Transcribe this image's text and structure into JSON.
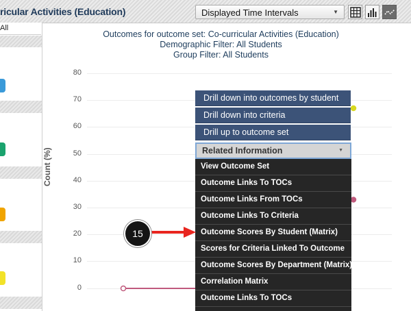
{
  "header": {
    "title": "ricular Activities (Education)",
    "interval_select": {
      "value": "Displayed Time Intervals"
    },
    "view_buttons": {
      "table_icon": "grid-icon",
      "bar_icon": "bar-chart-icon",
      "line_icon": "line-chart-icon"
    }
  },
  "sidebar": {
    "all_label": "All",
    "swatches": [
      {
        "color": "#3a9ad9"
      },
      {
        "color": "#1aa36e"
      },
      {
        "color": "#f0a400"
      },
      {
        "color": "#f2e228"
      }
    ]
  },
  "chart": {
    "heading_lines": [
      "Outcomes for outcome set: Co-curricular Activities (Education)",
      "Demographic Filter: All Students",
      "Group Filter: All Students"
    ],
    "ylabel": "Count (%)",
    "yticks": [
      "80",
      "70",
      "60",
      "50",
      "40",
      "30",
      "20",
      "10",
      "0"
    ]
  },
  "chart_data": {
    "type": "line",
    "title": "Outcomes for outcome set: Co-curricular Activities (Education)",
    "ylabel": "Count (%)",
    "ylim": [
      0,
      80
    ],
    "grid": true,
    "series": [
      {
        "color": "#c05a7d",
        "points": [
          0,
          0
        ]
      },
      {
        "color": "#d8d820",
        "points": [
          67
        ]
      },
      {
        "color": "#c05a7d",
        "points": [
          33
        ]
      }
    ]
  },
  "context_menu": {
    "drill_items": [
      "Drill down into outcomes by student",
      "Drill down into criteria",
      "Drill up to outcome set"
    ],
    "related_label": "Related Information",
    "related_items": [
      "View Outcome Set",
      "Outcome Links To TOCs",
      "Outcome Links From TOCs",
      "Outcome Links To Criteria",
      "Outcome Scores By Student (Matrix)",
      "Scores for Criteria Linked To Outcome",
      "Outcome Scores By Department (Matrix)",
      "Correlation Matrix",
      "Outcome Links To TOCs"
    ]
  },
  "annotation": {
    "step_number": "15",
    "arrow_color": "#e8251f"
  },
  "colors": {
    "menu_blue": "#3c5378",
    "menu_dark": "#262626",
    "title_blue": "#1f3a5a"
  }
}
